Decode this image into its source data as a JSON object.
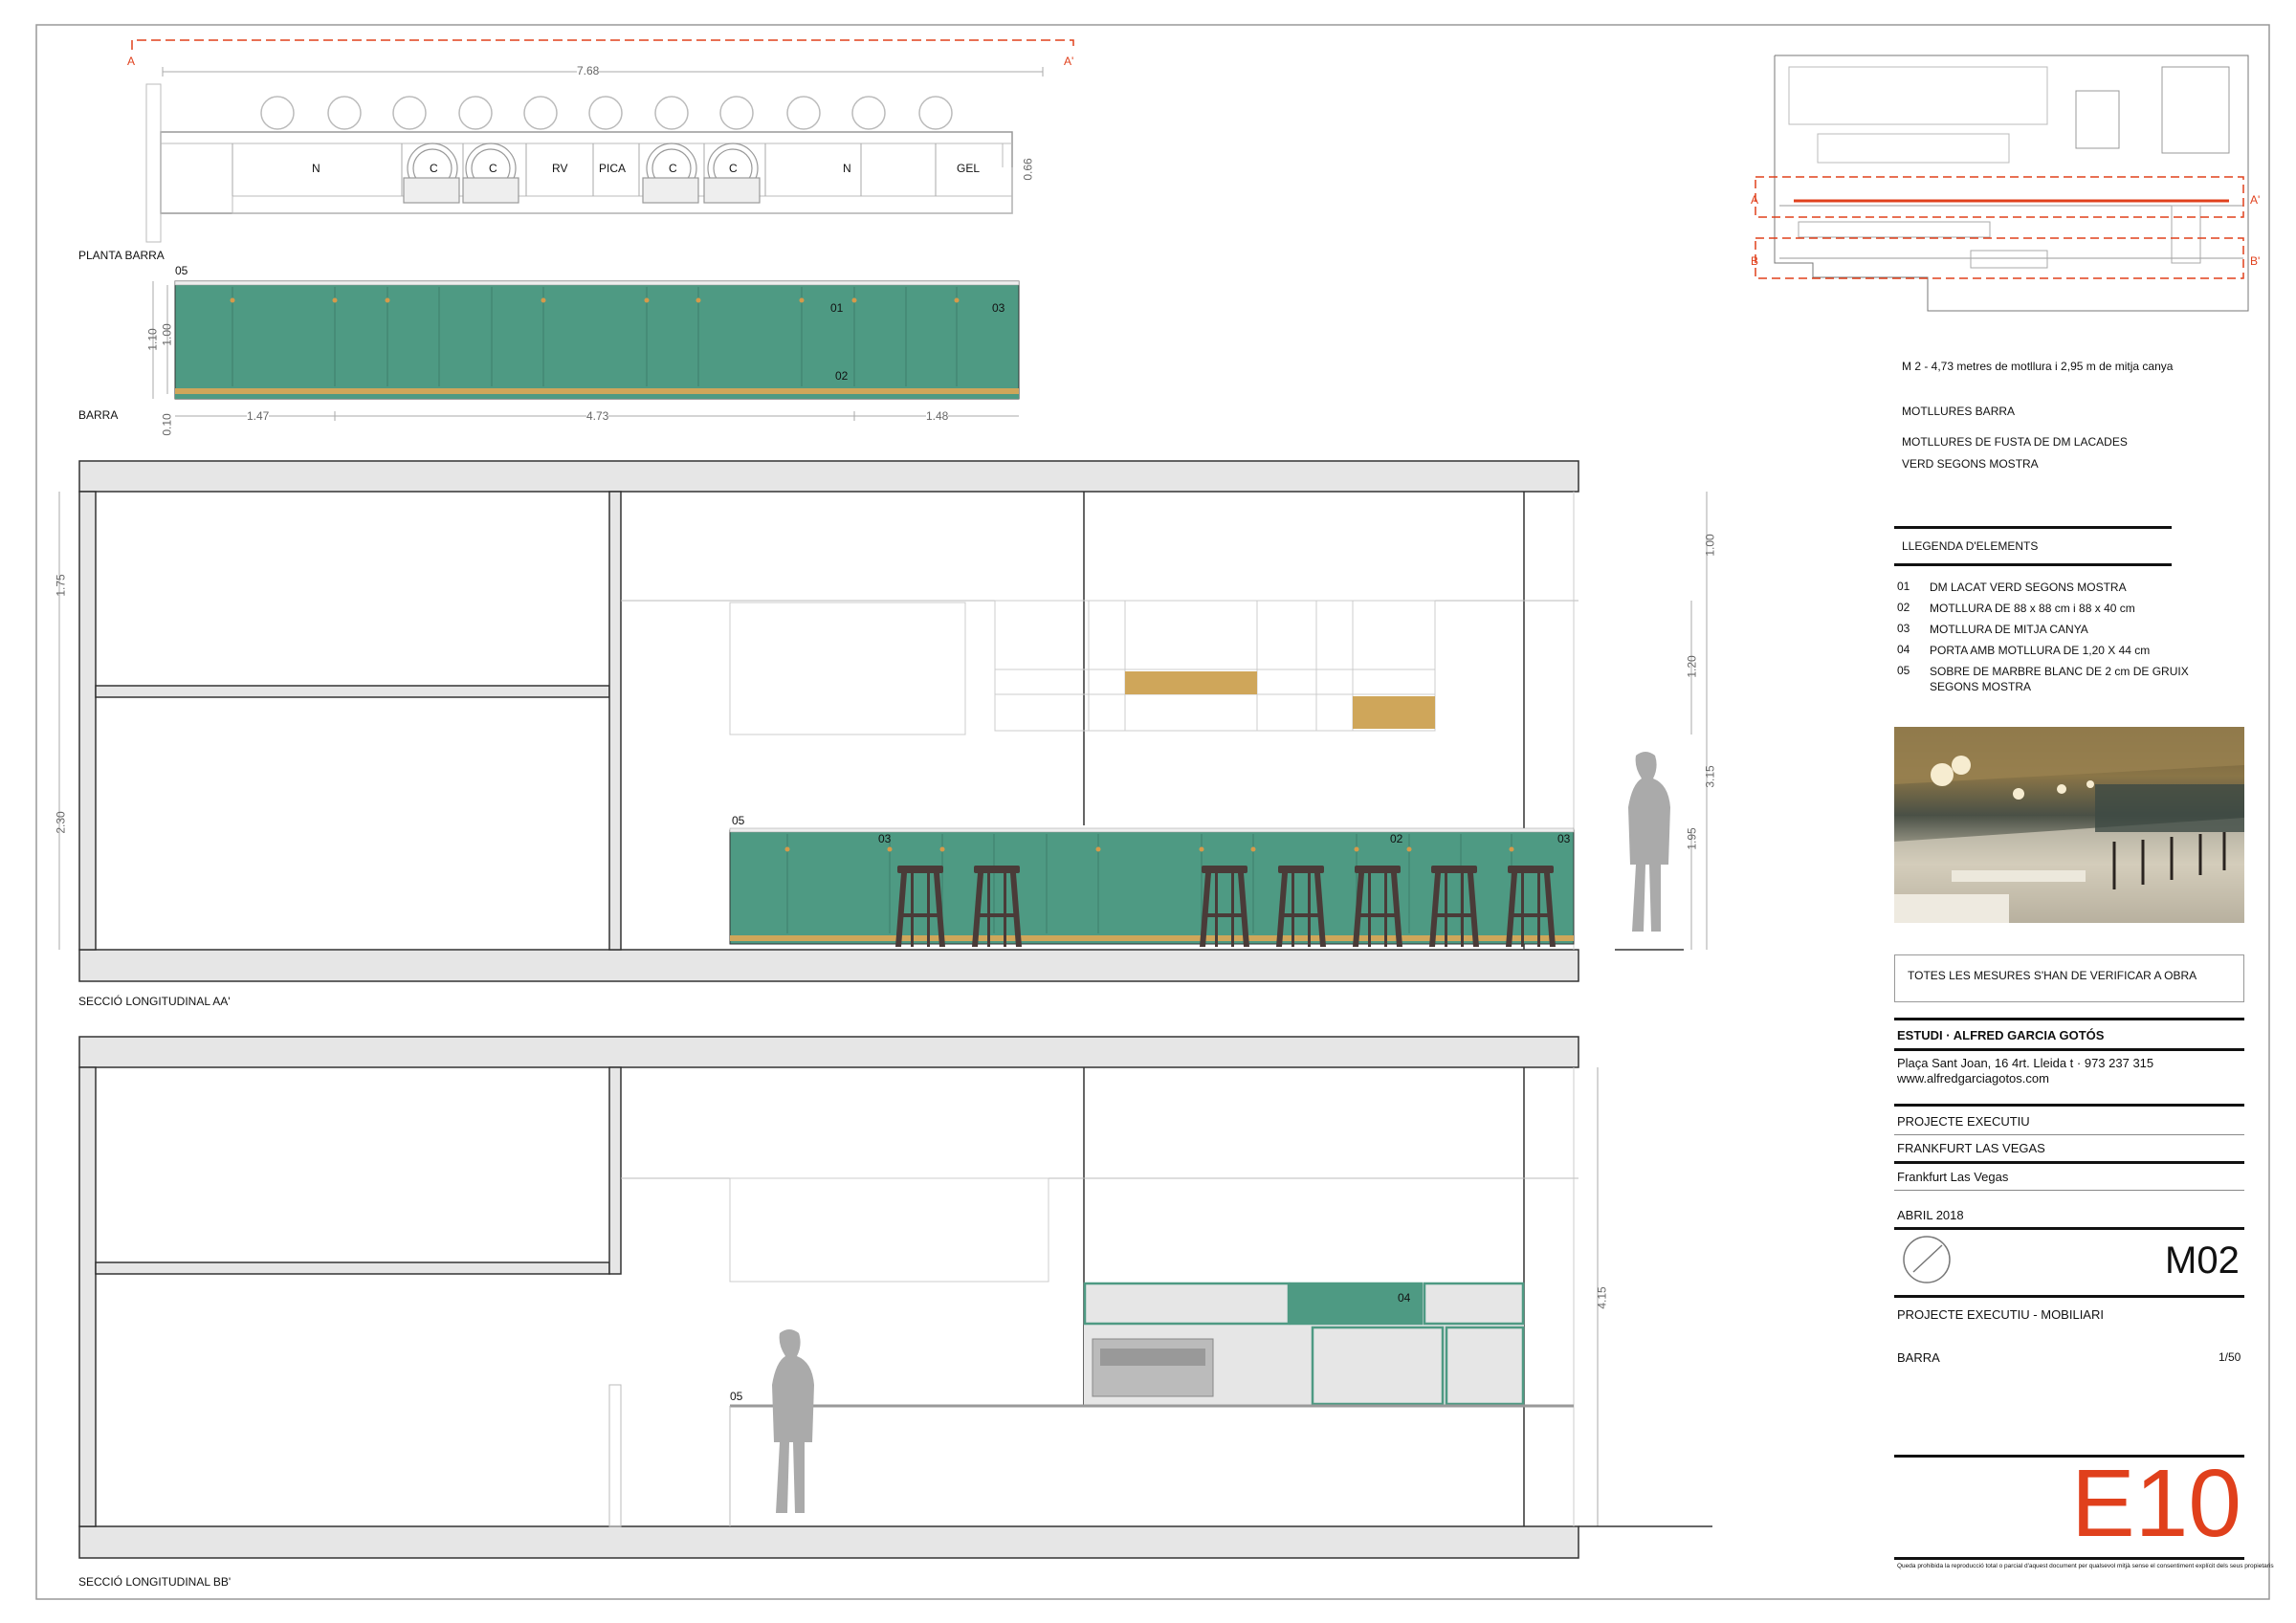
{
  "plan": {
    "section_marker_a_left": "A",
    "section_marker_a_right": "A'",
    "overall_dim": "7.68",
    "depth_dim": "0.66",
    "title": "PLANTA BARRA",
    "modules": [
      "N",
      "C",
      "C",
      "RV",
      "PICA",
      "C",
      "C",
      "N",
      "GEL"
    ]
  },
  "front": {
    "title": "BARRA",
    "tag_05": "05",
    "tag_01": "01",
    "tag_02": "02",
    "tag_03": "03",
    "height_dim_a": "1.10",
    "height_dim_b": "1.00",
    "base_dim": "0.10",
    "width_dims": [
      "1.47",
      "4.73",
      "1.48"
    ]
  },
  "section_aa": {
    "title": "SECCIÓ LONGITUDINAL AA'",
    "left_dims": [
      "1.75",
      "2.30"
    ],
    "right_dims": [
      "1.00",
      "1.20",
      "3.15",
      "1.95"
    ],
    "tags": [
      "05",
      "03",
      "02",
      "03"
    ]
  },
  "section_bb": {
    "title": "SECCIÓ LONGITUDINAL BB'",
    "right_dim": "4.15",
    "tags": [
      "04",
      "05"
    ]
  },
  "key_plan": {
    "markers": [
      "A",
      "A'",
      "B",
      "B'"
    ]
  },
  "notes": {
    "line1": "M 2 - 4,73 metres de motllura i 2,95 m de mitja canya",
    "line2": "MOTLLURES BARRA",
    "line3": "MOTLLURES DE FUSTA DE DM LACADES",
    "line4": "VERD SEGONS MOSTRA"
  },
  "legend": {
    "title": "LLEGENDA D'ELEMENTS",
    "items": [
      {
        "num": "01",
        "text": "DM LACAT VERD SEGONS MOSTRA"
      },
      {
        "num": "02",
        "text": "MOTLLURA DE 88 x 88 cm i 88 x 40 cm"
      },
      {
        "num": "03",
        "text": "MOTLLURA DE MITJA CANYA"
      },
      {
        "num": "04",
        "text": "PORTA AMB MOTLLURA DE 1,20 X 44 cm"
      },
      {
        "num": "05",
        "text": "SOBRE DE MARBRE BLANC DE 2 cm DE GRUIX SEGONS MOSTRA"
      }
    ]
  },
  "title_block": {
    "verify_note": "TOTES LES MESURES S'HAN DE VERIFICAR A OBRA",
    "studio": "ESTUDI · ALFRED GARCIA GOTÓS",
    "address": "Plaça Sant Joan, 16  4rt.  Lleida  t · 973 237 315",
    "web": "www.alfredgarciagotos.com",
    "project_type": "PROJECTE EXECUTIU",
    "project_name": "FRANKFURT LAS VEGAS",
    "client": "Frankfurt Las Vegas",
    "date": "ABRIL 2018",
    "sheet_code": "M02",
    "sheet_title": "PROJECTE EXECUTIU - MOBILIARI",
    "element": "BARRA",
    "scale": "1/50",
    "big_code": "E10",
    "disclaimer": "Queda prohibida la reproducció total o parcial d'aquest document per qualsevol mitjà sense el consentiment explícit dels seus propietaris"
  },
  "colors": {
    "green": "#4e9a83",
    "ochre": "#cfa65a",
    "accent": "#e0401c",
    "wall": "#e6e6e6",
    "stool": "#4a3b38"
  }
}
